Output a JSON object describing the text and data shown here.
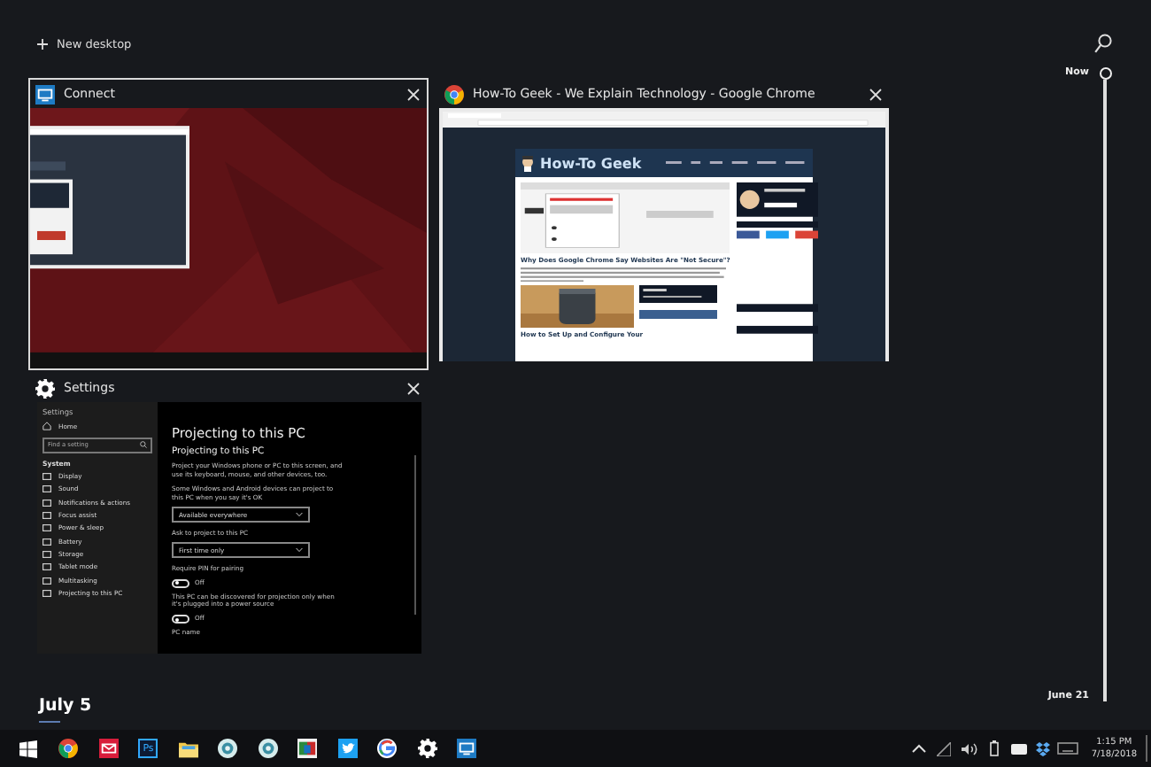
{
  "new_desktop": "New desktop",
  "windows": [
    {
      "kind": "connect",
      "title": "Connect",
      "selected": true
    },
    {
      "kind": "browser",
      "title": "How-To Geek - We Explain Technology - Google Chrome",
      "selected": false,
      "page": {
        "logo": "How-To Geek",
        "headline": "Why Does Google Chrome Say Websites Are \"Not Secure\"?",
        "second_headline": "How to Set Up and Configure Your"
      }
    },
    {
      "kind": "settings",
      "title": "Settings",
      "selected": false,
      "settings": {
        "app_label": "Settings",
        "home": "Home",
        "search_placeholder": "Find a setting",
        "section": "System",
        "nav": [
          "Display",
          "Sound",
          "Notifications & actions",
          "Focus assist",
          "Power & sleep",
          "Battery",
          "Storage",
          "Tablet mode",
          "Multitasking",
          "Projecting to this PC"
        ],
        "content": [
          {
            "kind": "title",
            "text": "Projecting to this PC"
          },
          {
            "kind": "subtitle",
            "text": "Projecting to this PC"
          },
          {
            "kind": "text",
            "text": "Project your Windows phone or PC to this screen, and use its keyboard, mouse, and other devices, too."
          },
          {
            "kind": "text",
            "text": "Some Windows and Android devices can project to this PC when you say it's OK"
          },
          {
            "kind": "dropdown",
            "value": "Available everywhere"
          },
          {
            "kind": "text",
            "text": "Ask to project to this PC"
          },
          {
            "kind": "dropdown",
            "value": "First time only"
          },
          {
            "kind": "text",
            "text": "Require PIN for pairing"
          },
          {
            "kind": "toggle",
            "on": false,
            "label": "Off"
          },
          {
            "kind": "text",
            "text": "This PC can be discovered for projection only when it's plugged into a power source"
          },
          {
            "kind": "toggle",
            "on": false,
            "label": "Off"
          },
          {
            "kind": "text",
            "text": "PC name"
          }
        ]
      }
    }
  ],
  "date_heading": "July 5",
  "timeline": {
    "now": "Now",
    "end": "June 21"
  },
  "taskbar": {
    "apps": [
      {
        "kind": "start"
      },
      {
        "kind": "chrome"
      },
      {
        "kind": "mail"
      },
      {
        "kind": "photoshop",
        "label": "Ps"
      },
      {
        "kind": "folder"
      },
      {
        "kind": "round"
      },
      {
        "kind": "round"
      },
      {
        "kind": "tiles"
      },
      {
        "kind": "bird"
      },
      {
        "kind": "ring"
      },
      {
        "kind": "gear"
      },
      {
        "kind": "connect"
      }
    ],
    "tray": [
      {
        "kind": "caret"
      },
      {
        "kind": "signal"
      },
      {
        "kind": "speaker"
      },
      {
        "kind": "battery"
      },
      {
        "kind": "card"
      },
      {
        "kind": "box"
      },
      {
        "kind": "keyboard"
      }
    ],
    "time": "1:15 PM",
    "date": "7/18/2018"
  }
}
